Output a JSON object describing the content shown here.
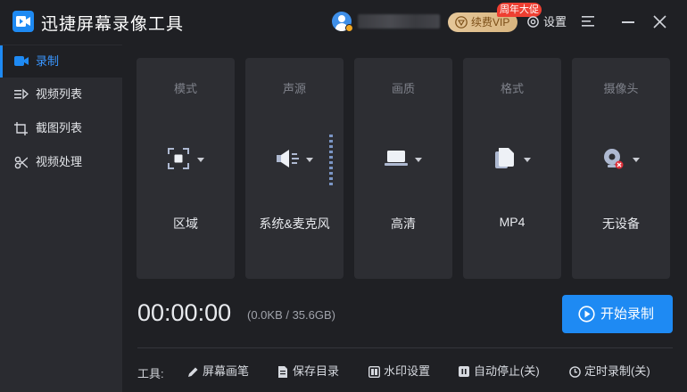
{
  "app": {
    "title": "迅捷屏幕录像工具"
  },
  "header": {
    "vip_label": "续费VIP",
    "promo_badge": "周年大促",
    "settings_label": "设置"
  },
  "sidebar": {
    "items": [
      {
        "label": "录制",
        "icon": "video-camera-icon",
        "active": true
      },
      {
        "label": "视频列表",
        "icon": "video-list-icon",
        "active": false
      },
      {
        "label": "截图列表",
        "icon": "screenshot-list-icon",
        "active": false
      },
      {
        "label": "视频处理",
        "icon": "video-process-icon",
        "active": false
      }
    ]
  },
  "cards": [
    {
      "title": "模式",
      "value": "区域",
      "icon": "region-select-icon"
    },
    {
      "title": "声源",
      "value": "系统&麦克风",
      "icon": "speaker-icon"
    },
    {
      "title": "画质",
      "value": "高清",
      "icon": "laptop-icon"
    },
    {
      "title": "格式",
      "value": "MP4",
      "icon": "file-icon"
    },
    {
      "title": "摄像头",
      "value": "无设备",
      "icon": "webcam-off-icon"
    }
  ],
  "recorder": {
    "timer": "00:00:00",
    "size_info": "(0.0KB / 35.6GB)",
    "start_label": "开始录制"
  },
  "toolbar": {
    "label": "工具:",
    "items": [
      {
        "label": "屏幕画笔",
        "icon": "pen-icon"
      },
      {
        "label": "保存目录",
        "icon": "folder-doc-icon"
      },
      {
        "label": "水印设置",
        "icon": "watermark-icon"
      },
      {
        "label": "自动停止(关)",
        "icon": "pause-icon"
      },
      {
        "label": "定时录制(关)",
        "icon": "clock-icon"
      }
    ]
  },
  "colors": {
    "accent": "#1e8af3",
    "background": "#1f2024",
    "sidebar": "#2a2b30",
    "card": "#2d2e33",
    "promo": "#ee3f32",
    "vip_gold": "#e5c79a"
  }
}
